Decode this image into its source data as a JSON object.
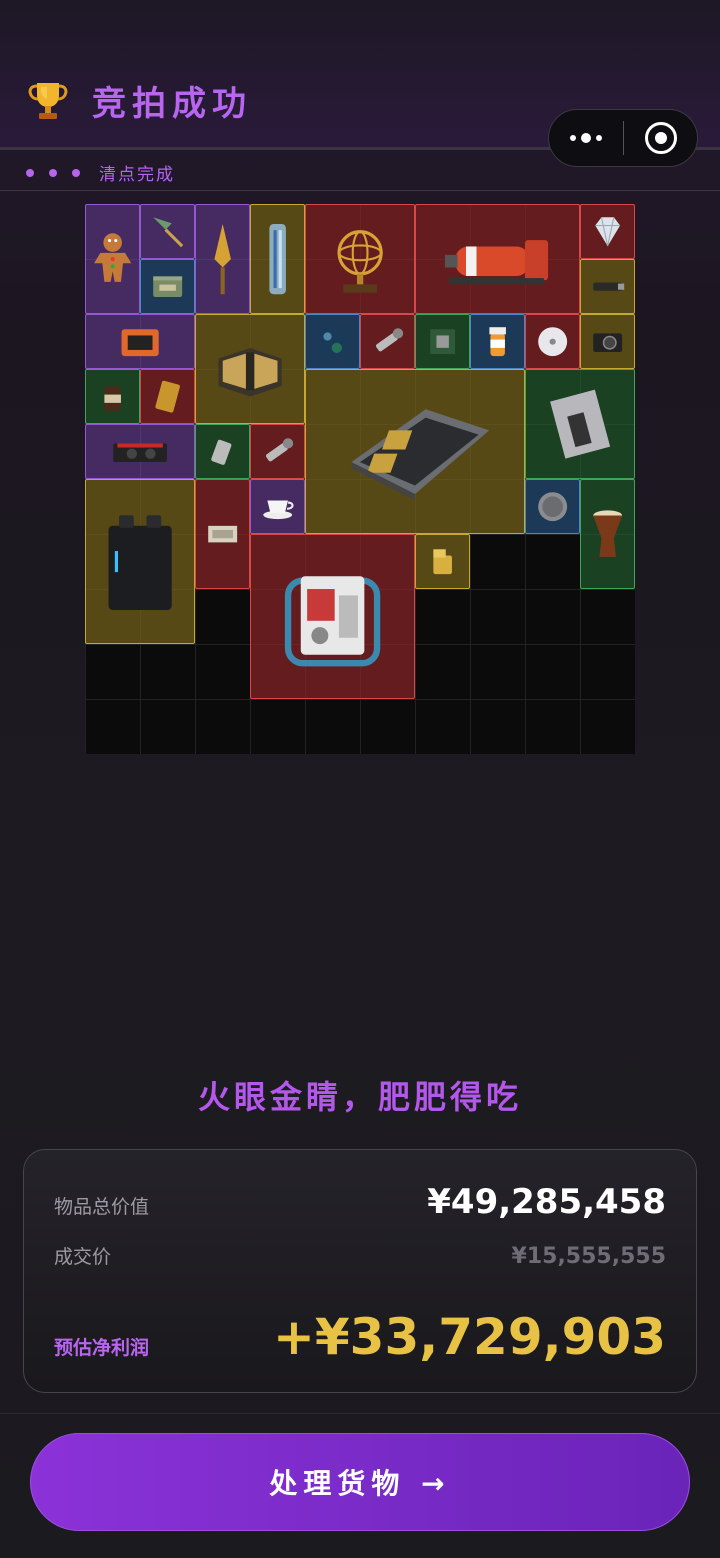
{
  "header": {
    "title": "竞拍成功",
    "status": "清点完成"
  },
  "capsule": {
    "more_icon": "more-dots-icon",
    "close_icon": "target-icon"
  },
  "slogan": "火眼金睛，肥肥得吃",
  "summary": {
    "total_value_label": "物品总价值",
    "total_value": "¥49,285,458",
    "deal_price_label": "成交价",
    "deal_price": "¥15,555,555",
    "profit_label": "预估净利润",
    "profit": "+¥33,729,903"
  },
  "action": {
    "button_label": "处理货物 →"
  },
  "colors": {
    "accent": "#b865f0",
    "profit": "#e8c244",
    "rarity_purple": "#9458d4",
    "rarity_blue": "#4a86c8",
    "rarity_green": "#3fa558",
    "rarity_gold": "#c8a92f",
    "rarity_red": "#d8484a"
  },
  "items": [
    {
      "name": "gingerbread-man",
      "rarity": "purple"
    },
    {
      "name": "arrow-tip",
      "rarity": "purple"
    },
    {
      "name": "golden-spearhead",
      "rarity": "purple"
    },
    {
      "name": "glass-capsule",
      "rarity": "gold"
    },
    {
      "name": "armillary-sphere",
      "rarity": "red"
    },
    {
      "name": "fire-extinguisher-bottle",
      "rarity": "red"
    },
    {
      "name": "diamond",
      "rarity": "red"
    },
    {
      "name": "ammo-tin",
      "rarity": "blue"
    },
    {
      "name": "usb-stick",
      "rarity": "gold"
    },
    {
      "name": "orange-box",
      "rarity": "purple"
    },
    {
      "name": "ammo-crate",
      "rarity": "gold"
    },
    {
      "name": "glass-orb",
      "rarity": "blue"
    },
    {
      "name": "flashlight",
      "rarity": "red"
    },
    {
      "name": "chip-board",
      "rarity": "green"
    },
    {
      "name": "pill-bottle",
      "rarity": "blue"
    },
    {
      "name": "cd-disc",
      "rarity": "red"
    },
    {
      "name": "camera",
      "rarity": "gold"
    },
    {
      "name": "coffee-jar",
      "rarity": "green"
    },
    {
      "name": "tarot-card",
      "rarity": "red"
    },
    {
      "name": "server-motherboard",
      "rarity": "gold"
    },
    {
      "name": "magazine",
      "rarity": "green"
    },
    {
      "name": "graphics-card",
      "rarity": "purple"
    },
    {
      "name": "lighter",
      "rarity": "green"
    },
    {
      "name": "flashlight-2",
      "rarity": "red"
    },
    {
      "name": "power-station",
      "rarity": "gold"
    },
    {
      "name": "banknote",
      "rarity": "red"
    },
    {
      "name": "teacup",
      "rarity": "purple"
    },
    {
      "name": "coin",
      "rarity": "blue"
    },
    {
      "name": "djembe-drum",
      "rarity": "green"
    },
    {
      "name": "zippo-lighter",
      "rarity": "gold"
    },
    {
      "name": "engine-unit",
      "rarity": "red"
    }
  ]
}
